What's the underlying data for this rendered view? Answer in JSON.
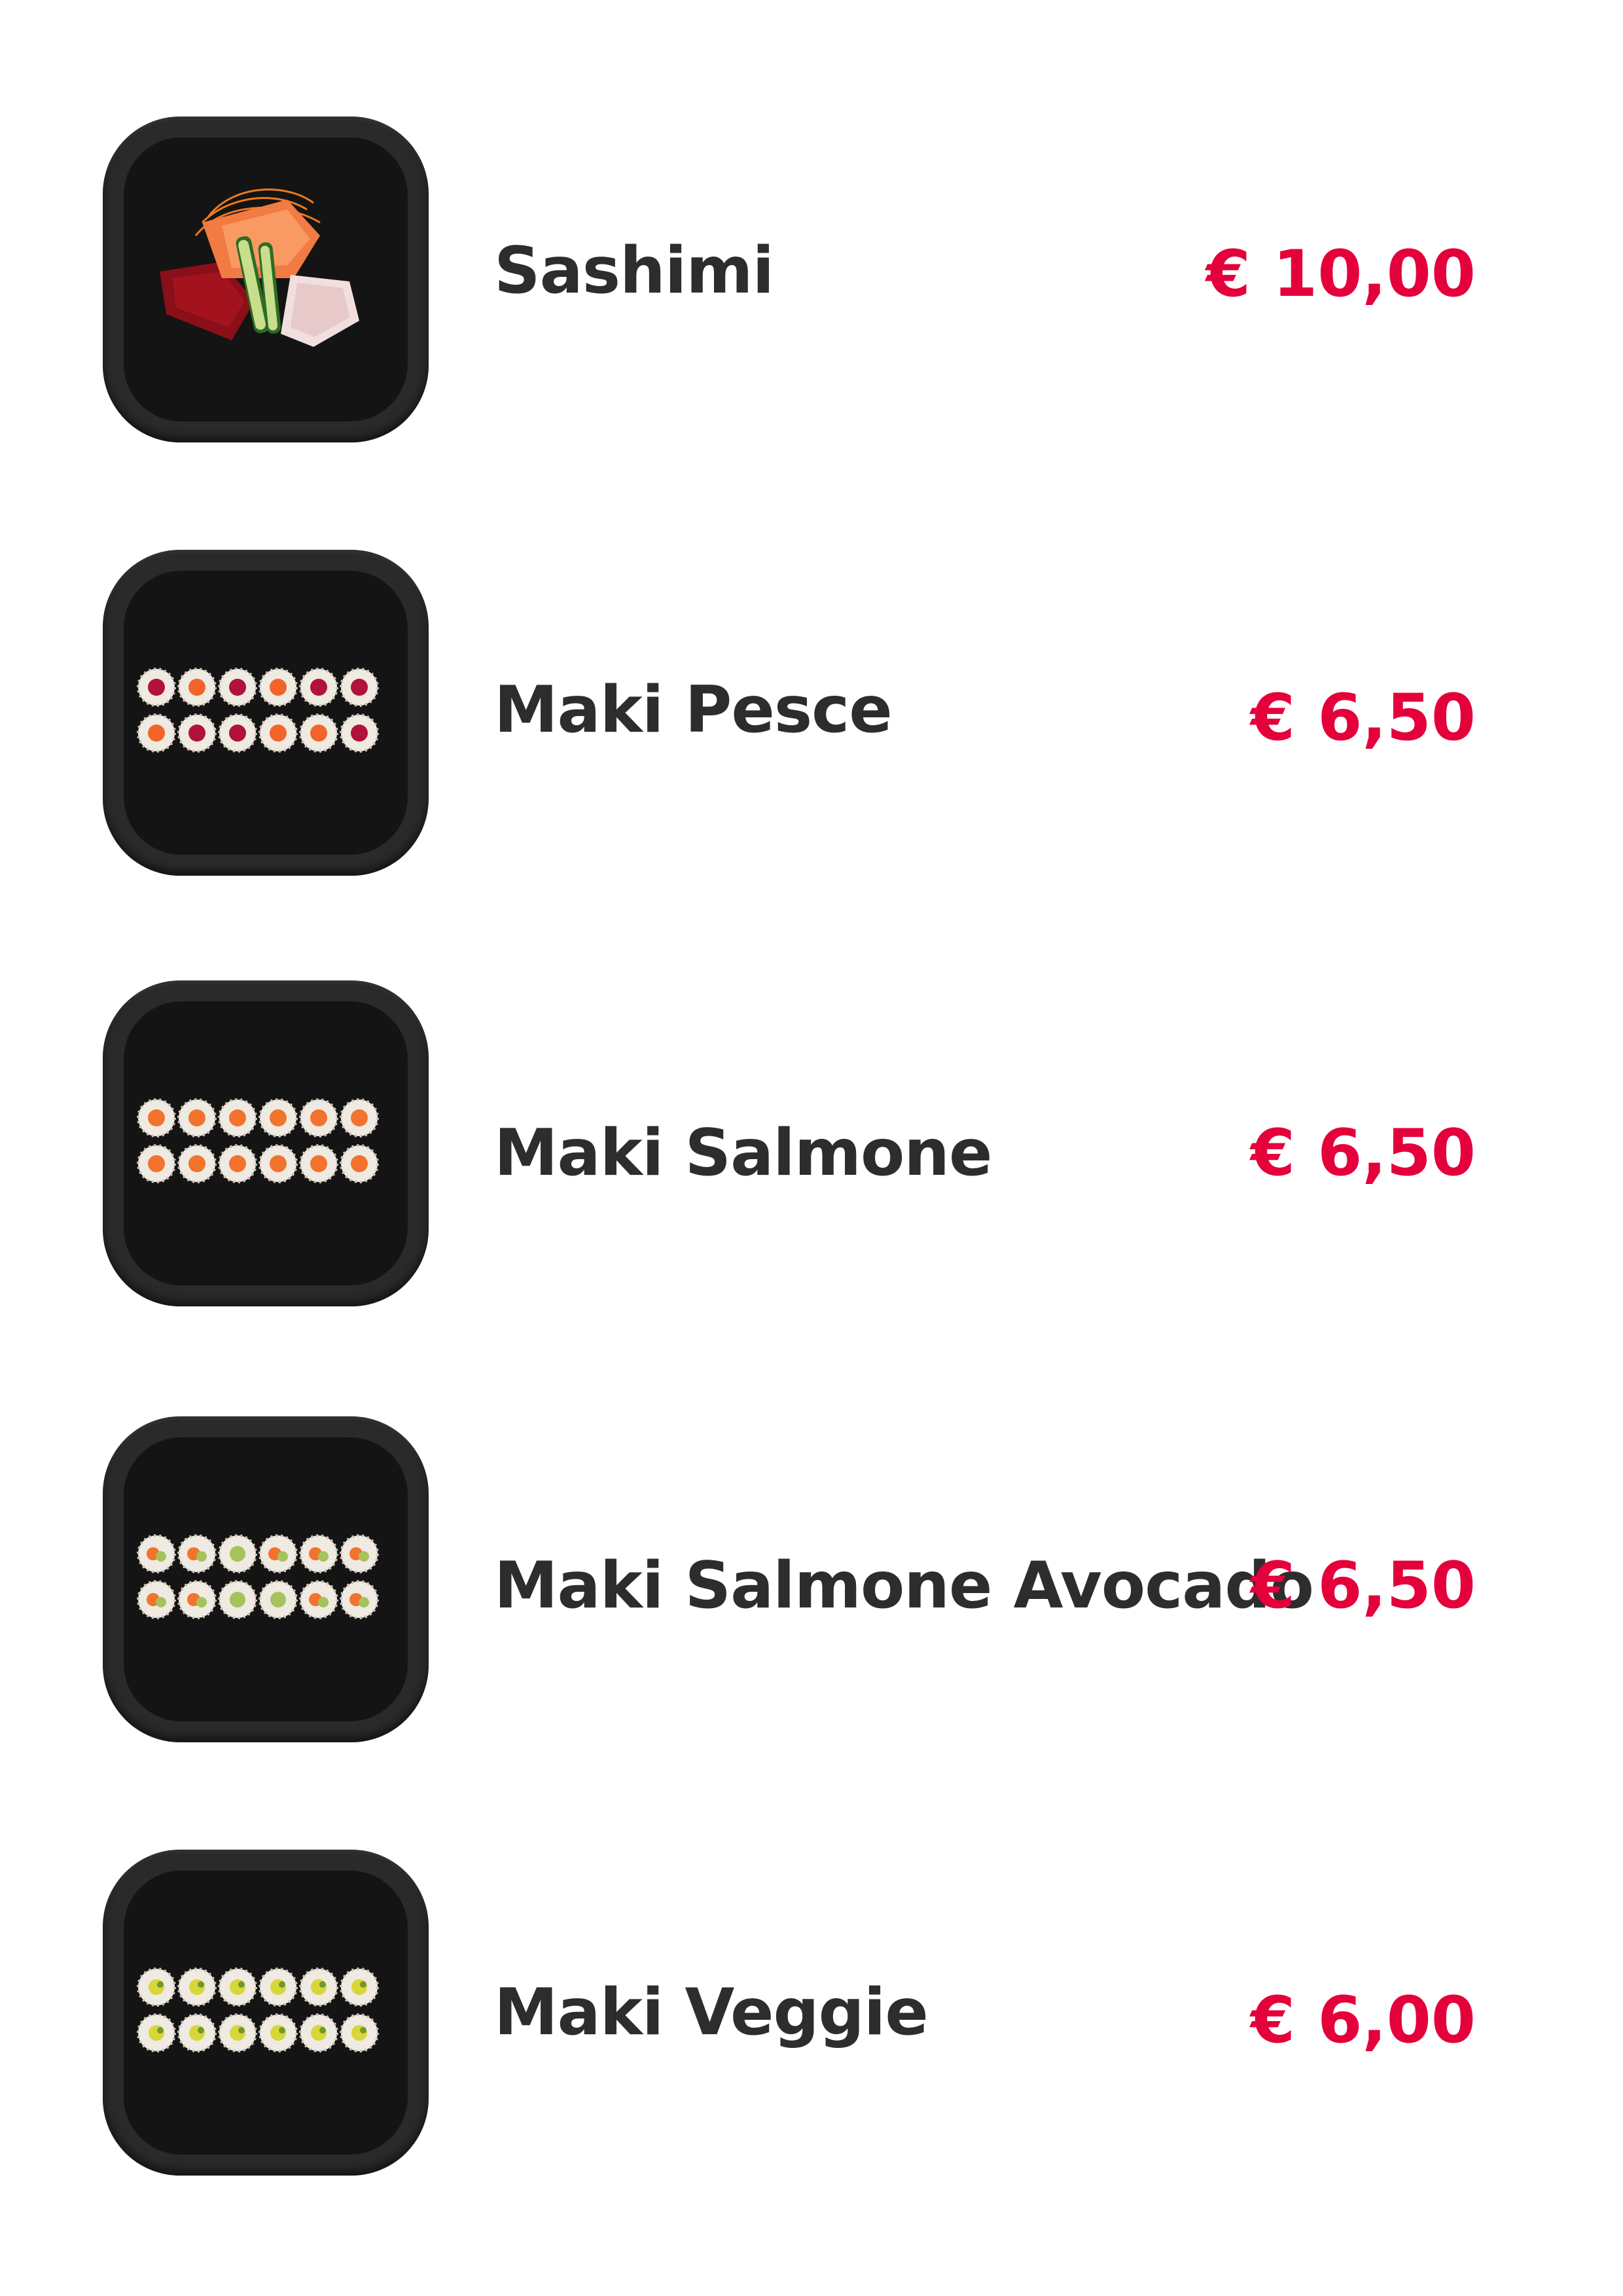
{
  "accent_color": "#e4003a",
  "items": [
    {
      "name": "Sashimi",
      "price": "€ 10,00",
      "image": "sashimi-plate"
    },
    {
      "name": "Maki Pesce",
      "price": "€ 6,50",
      "image": "maki-pesce-rolls"
    },
    {
      "name": "Maki Salmone",
      "price": "€ 6,50",
      "image": "maki-salmone-rolls"
    },
    {
      "name": "Maki Salmone Avocado",
      "price": "€ 6,50",
      "image": "maki-salmone-avocado-rolls"
    },
    {
      "name": "Maki Veggie",
      "price": "€ 6,00",
      "image": "maki-veggie-rolls"
    }
  ]
}
